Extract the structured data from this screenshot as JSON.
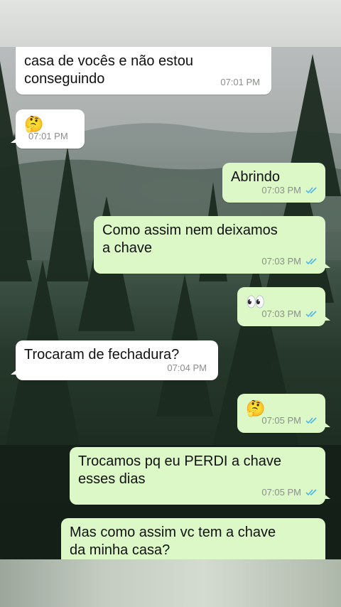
{
  "colors": {
    "incoming_bubble": "#ffffff",
    "outgoing_bubble": "#dcf8c6",
    "timestamp": "#8a8f8a",
    "read_ticks": "#4fb6ec"
  },
  "messages": [
    {
      "direction": "incoming",
      "text": "casa de vocês e não estou\nconseguindo",
      "time": "07:01 PM"
    },
    {
      "direction": "incoming",
      "text": "🤔",
      "time": "07:01 PM"
    },
    {
      "direction": "outgoing",
      "text": "Abrindo",
      "time": "07:03 PM",
      "status": "read"
    },
    {
      "direction": "outgoing",
      "text": "Como assim nem deixamos\na chave",
      "time": "07:03 PM",
      "status": "read"
    },
    {
      "direction": "outgoing",
      "text": "👀",
      "time": "07:03 PM",
      "status": "read"
    },
    {
      "direction": "incoming",
      "text": "Trocaram de fechadura?",
      "time": "07:04 PM"
    },
    {
      "direction": "outgoing",
      "text": "🤔",
      "time": "07:05 PM",
      "status": "read"
    },
    {
      "direction": "outgoing",
      "text": "Trocamos pq eu PERDI a chave\nesses dias",
      "time": "07:05 PM",
      "status": "read"
    },
    {
      "direction": "outgoing",
      "text": "Mas como assim vc tem a chave\nda minha casa?",
      "time": "",
      "status": ""
    }
  ]
}
